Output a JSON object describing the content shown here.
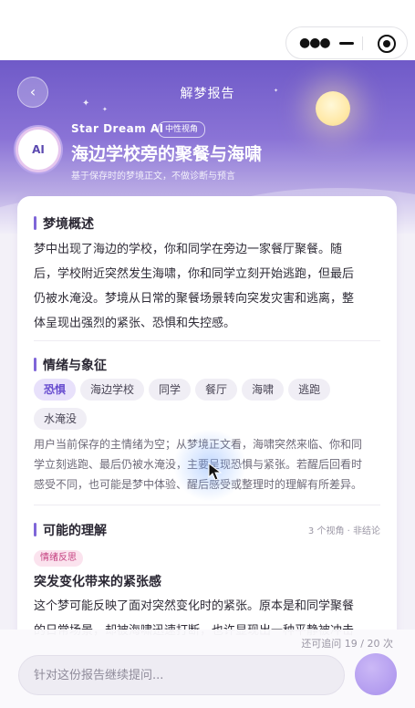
{
  "header": {
    "title": "解梦报告",
    "back_icon": "chevron-left-icon",
    "capsule": {
      "more_icon": "more-dots-icon",
      "minimize_icon": "minimize-icon",
      "close_icon": "target-close-icon"
    }
  },
  "profile": {
    "avatar_text": "AI",
    "brand": "Star Dream AI",
    "brand_tag": "中性视角",
    "report_title": "海边学校旁的聚餐与海啸",
    "subtitle": "基于保存时的梦境正文，不做诊断与预言"
  },
  "sections": {
    "overview": {
      "heading": "梦境概述",
      "lines": [
        "梦中出现了海边的学校，你和同学在旁边一家餐厅聚餐。随",
        "后，学校附近突然发生海啸，你和同学立刻开始逃跑，但最后",
        "仍被水淹没。梦境从日常的聚餐场景转向突发灾害和逃离，整",
        "体呈现出强烈的紧张、恐惧和失控感。"
      ]
    },
    "emotion": {
      "heading": "情绪与象征",
      "tags": [
        "恐惧",
        "海边学校",
        "同学",
        "餐厅",
        "海啸",
        "逃跑",
        "水淹没"
      ],
      "lines": [
        "用户当前保存的主情绪为空；从梦境正文看，海啸突然来临、你和同",
        "学立刻逃跑、最后仍被水淹没，主要呈现恐惧与紧张。若醒后回看时",
        "感受不同，也可能是梦中体验、醒后感受或整理时的理解有所差异。"
      ]
    },
    "interpretation": {
      "heading": "可能的理解",
      "meta": "3 个视角 · 非结论",
      "pill": "情绪反思",
      "sub_title": "突发变化带来的紧张感",
      "lines": [
        "这个梦可能反映了面对突然变化时的紧张。原本是和同学聚餐",
        "的日常场景，却被海啸迅速打断，也许显现出一种平静被冲击"
      ]
    }
  },
  "composer": {
    "quota": "还可追问 19 / 20 次",
    "placeholder": "针对这份报告继续提问...",
    "send_icon": "send-icon"
  },
  "colors": {
    "accent": "#7f66d8",
    "hero_top": "#6f5ac8",
    "pill_bg": "#fbe3ee",
    "pill_text": "#c43f7f"
  }
}
